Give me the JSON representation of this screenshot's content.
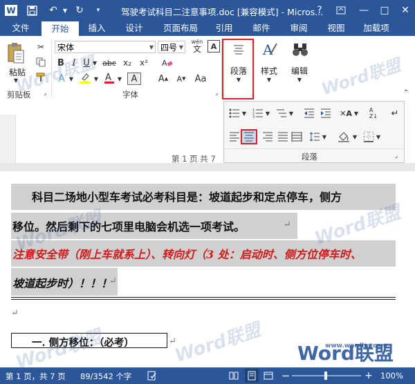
{
  "window": {
    "title": "驾驶考试科目二注意事项.doc [兼容模式] - Micros...",
    "help": "?",
    "minimize": "—",
    "restore": "□",
    "close": "✕"
  },
  "tabs": [
    "文件",
    "开始",
    "插入",
    "设计",
    "页面布局",
    "引用",
    "邮件",
    "审阅",
    "视图",
    "加载项"
  ],
  "ribbon": {
    "paste_label": "粘贴",
    "clipboard_label": "剪贴板",
    "font_name": "宋体",
    "font_size": "四号",
    "font_group_label": "字体",
    "wen_label": "wén",
    "paragraph_label": "段落",
    "style_label": "样式",
    "edit_label": "编辑",
    "bold": "B",
    "italic": "I",
    "underline": "U",
    "strike": "abc",
    "sub": "x₂",
    "sup": "x²"
  },
  "para_panel": {
    "label": "段落"
  },
  "ruler_text": "第 1 页 共 7",
  "document": {
    "line1": "科目二场地小型车考试必考科目是：坡道起步和定点停车，侧方",
    "line2": "移位。然后剩下的七项里电脑会机选一项考试。",
    "line3": "注意安全带（刚上车就系上）、转向灯（3 处：启动时、侧方位停车时、",
    "line4": "坡道起步时）！！！",
    "heading": "一. 侧方移位：（必考）",
    "para_mark": "↵"
  },
  "status": {
    "page": "第 1 页，共 7 页",
    "words": "89/3542 个字",
    "zoom": "100%",
    "zoom_minus": "−",
    "zoom_plus": "+"
  },
  "watermark": {
    "brand": "Word联盟",
    "url": "www.wordlm.com"
  }
}
